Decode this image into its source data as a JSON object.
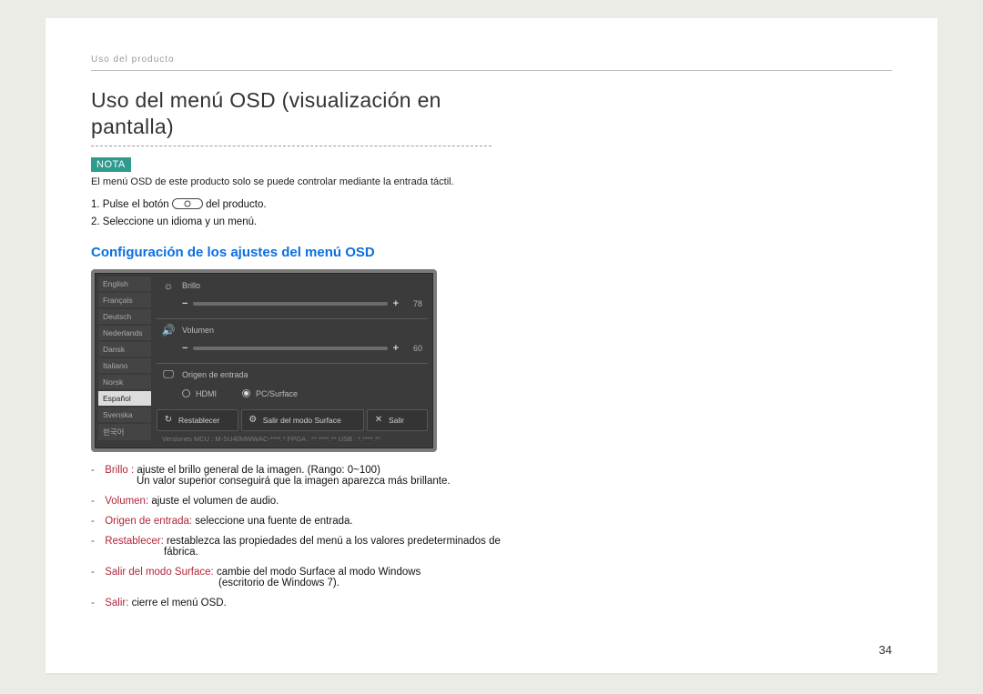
{
  "breadcrumb": "Uso del producto",
  "title": "Uso del menú OSD (visualización en pantalla)",
  "note": {
    "badge": "NOTA",
    "text": "El menú OSD de este producto solo se puede controlar mediante la entrada táctil."
  },
  "steps": {
    "s1_pre": "1. Pulse el botón ",
    "s1_post": " del producto.",
    "s2": "2. Seleccione un idioma y un menú."
  },
  "section_heading": "Configuración de los ajustes del menú OSD",
  "osd": {
    "languages": [
      "English",
      "Français",
      "Deutsch",
      "Nederlands",
      "Dansk",
      "Italiano",
      "Norsk",
      "Español",
      "Svenska",
      "한국어"
    ],
    "selected_language_index": 7,
    "brightness": {
      "label": "Brillo",
      "value": "78"
    },
    "volume": {
      "label": "Volumen",
      "value": "60"
    },
    "input": {
      "label": "Origen de entrada",
      "opt1": "HDMI",
      "opt2": "PC/Surface",
      "selected": "PC/Surface"
    },
    "buttons": {
      "reset": "Restablecer",
      "exit_surface": "Salir del modo Surface",
      "exit": "Salir"
    },
    "versions": "Versiones    MCU : M-SU40MWWAC-****.*    FPGA : **.****.**    USB : *.****.**"
  },
  "defs": {
    "brillo_term": "Brillo :",
    "brillo_desc": " ajuste el brillo general de la imagen. (Rango: 0~100)",
    "brillo_cont": "Un valor superior conseguirá que la imagen aparezca más brillante.",
    "volumen_term": "Volumen:",
    "volumen_desc": " ajuste el volumen de audio.",
    "origen_term": "Origen de entrada:",
    "origen_desc": " seleccione una fuente de entrada.",
    "restablecer_term": "Restablecer:",
    "restablecer_desc": " restablezca las propiedades del menú a los valores predeterminados de",
    "restablecer_cont": "fábrica.",
    "surface_term": "Salir del modo Surface:",
    "surface_desc": " cambie del modo Surface al modo Windows",
    "surface_cont": "(escritorio de Windows 7).",
    "salir_term": "Salir:",
    "salir_desc": " cierre el menú OSD."
  },
  "page_number": "34"
}
